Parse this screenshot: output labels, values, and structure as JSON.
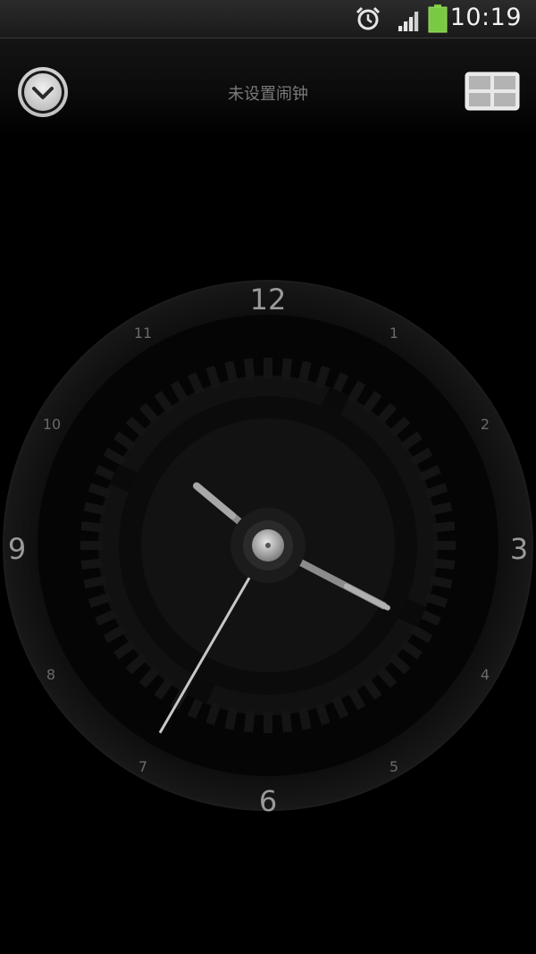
{
  "status_bar": {
    "time": "10:19",
    "icons": [
      "alarm-clock-icon",
      "signal-strength-icon",
      "battery-icon"
    ],
    "battery_color": "#7ac943"
  },
  "header": {
    "title": "未设置闹钟",
    "left_button_icon": "chevron-down-circle-icon",
    "right_button_icon": "grid-layout-icon"
  },
  "clock": {
    "numerals": {
      "n12": "12",
      "n1": "1",
      "n2": "2",
      "n3": "3",
      "n4": "4",
      "n5": "5",
      "n6": "6",
      "n7": "7",
      "n8": "8",
      "n9": "9",
      "n10": "10",
      "n11": "11"
    },
    "time": {
      "hour": 10,
      "minute": 19,
      "second": 35
    },
    "colors": {
      "hands": "#9a9a9a",
      "numerals_major": "#8a8a8a",
      "numerals_minor": "#6a6a6a"
    }
  }
}
